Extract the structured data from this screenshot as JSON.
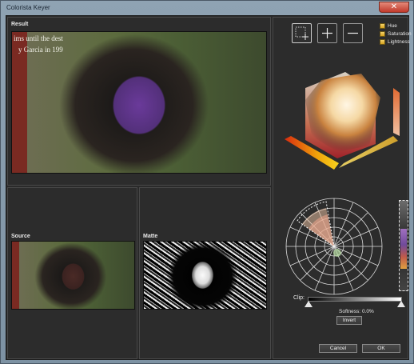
{
  "window": {
    "title": "Colorista Keyer",
    "close_glyph": "✕"
  },
  "panels": {
    "result": {
      "label": "Result",
      "sign_lines": [
        "ims until the dest",
        "y Garcia in 199"
      ]
    },
    "source": {
      "label": "Source"
    },
    "matte": {
      "label": "Matte"
    }
  },
  "tools": {
    "select_icon": "select-add-icon",
    "plus_icon": "plus-icon",
    "minus_icon": "minus-icon",
    "checks": [
      {
        "label": "Hue",
        "checked": true
      },
      {
        "label": "Saturation",
        "checked": true
      },
      {
        "label": "Lightness",
        "checked": true
      }
    ]
  },
  "controls": {
    "clip_label": "Clip:",
    "softness_label": "Softness:",
    "softness_value": "0.0%",
    "invert_label": "Invert",
    "cancel_label": "Cancel",
    "ok_label": "OK"
  },
  "colors": {
    "accent_check": "#e0ad2a",
    "panel_bg": "#2c2c2c",
    "frame": "#8fa3b3"
  }
}
